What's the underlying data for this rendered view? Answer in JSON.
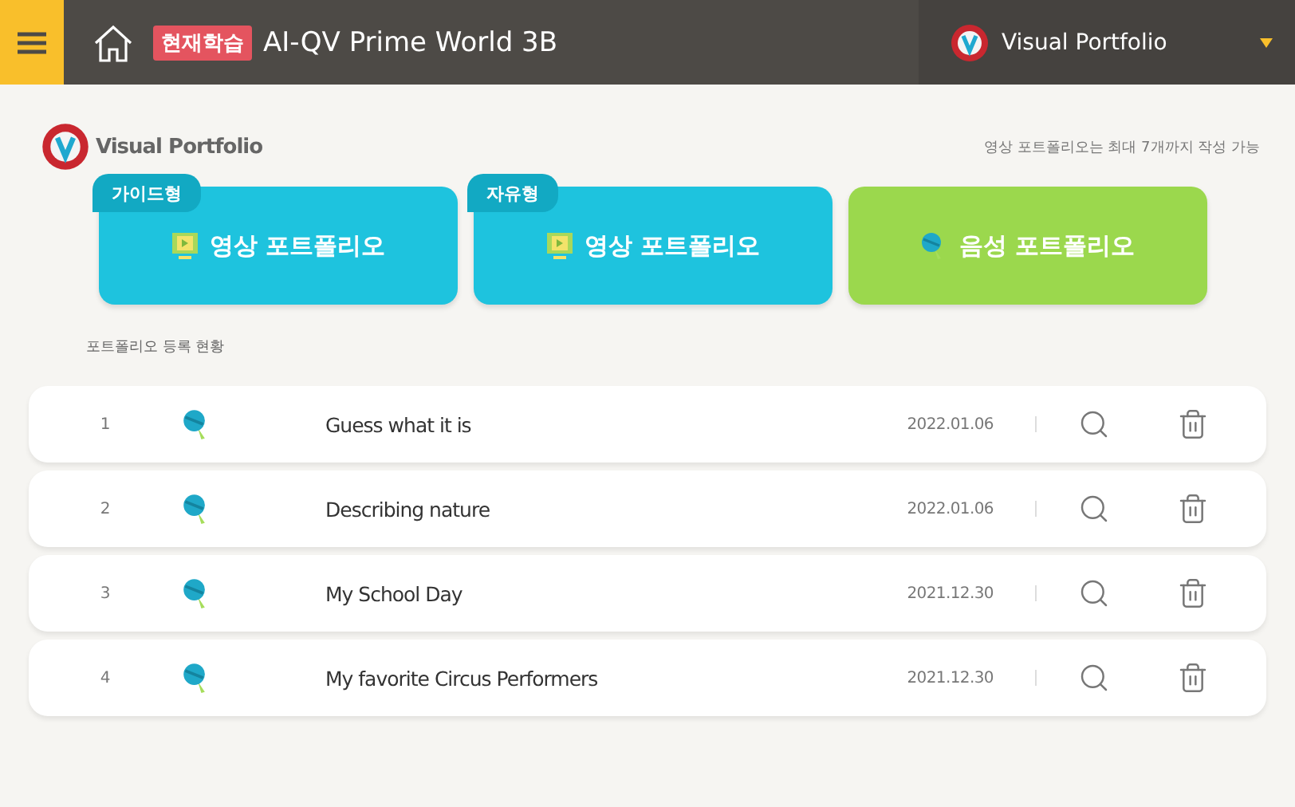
{
  "header": {
    "badge": "현재학습",
    "title": "AI-QV Prime World 3B",
    "menu_title": "Visual Portfolio"
  },
  "section": {
    "title": "Visual Portfolio",
    "note": "영상 포트폴리오는 최대 7개까지 작성 가능"
  },
  "cards": [
    {
      "kind": "video",
      "tag": "가이드형",
      "label": "영상 포트폴리오"
    },
    {
      "kind": "video",
      "tag": "자유형",
      "label": "영상 포트폴리오"
    },
    {
      "kind": "audio",
      "label": "음성 포트폴리오"
    }
  ],
  "list_title": "포트폴리오 등록 현황",
  "rows": [
    {
      "number": "1",
      "title": "Guess what it is",
      "date": "2022.01.06"
    },
    {
      "number": "2",
      "title": "Describing nature",
      "date": "2022.01.06"
    },
    {
      "number": "3",
      "title": "My School Day",
      "date": "2021.12.30"
    },
    {
      "number": "4",
      "title": "My favorite Circus Performers",
      "date": "2021.12.30"
    }
  ]
}
